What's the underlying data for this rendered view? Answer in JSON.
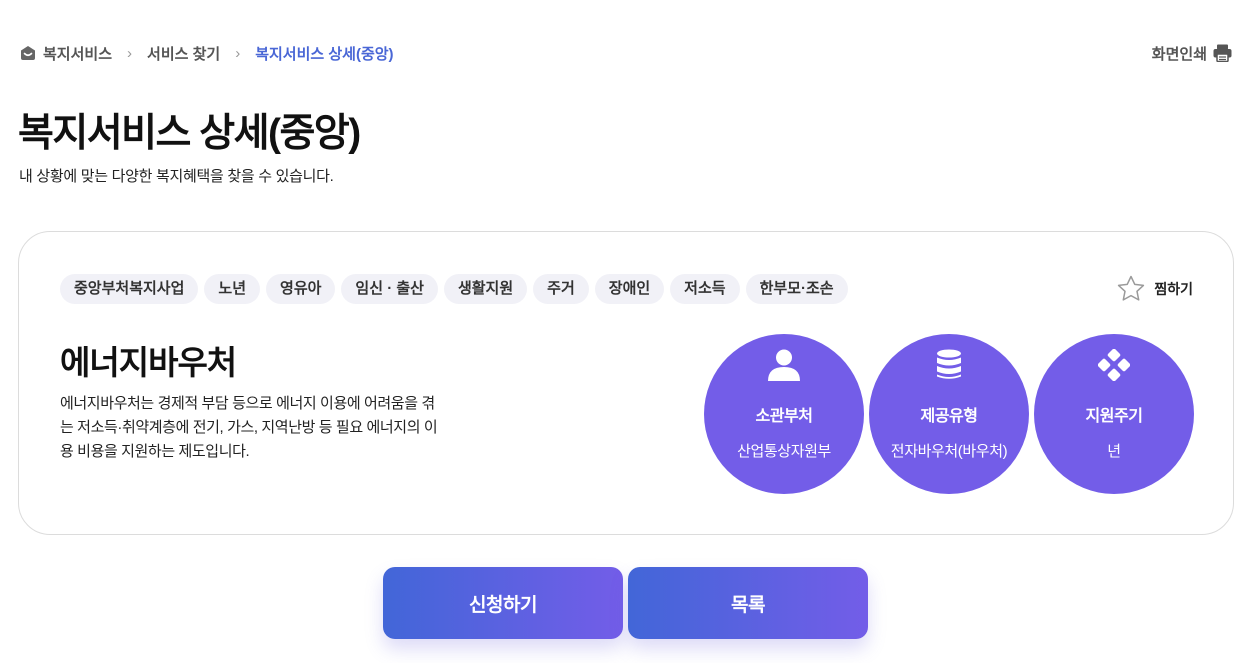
{
  "breadcrumb": {
    "items": [
      "복지서비스",
      "서비스 찾기",
      "복지서비스 상세(중앙)"
    ]
  },
  "print_label": "화면인쇄",
  "page": {
    "title": "복지서비스 상세(중앙)",
    "subtitle": "내 상황에 맞는 다양한 복지혜택을 찾을 수 있습니다."
  },
  "service": {
    "tags": [
      "중앙부처복지사업",
      "노년",
      "영유아",
      "임신 · 출산",
      "생활지원",
      "주거",
      "장애인",
      "저소득",
      "한부모·조손"
    ],
    "favorite_label": "찜하기",
    "title": "에너지바우처",
    "description": "에너지바우처는 경제적 부담 등으로 에너지 이용에 어려움을 겪는 저소득·취약계층에 전기, 가스, 지역난방 등 필요 에너지의 이용 비용을 지원하는 제도입니다.",
    "info": [
      {
        "icon": "person-icon",
        "label": "소관부처",
        "value": "산업통상자원부"
      },
      {
        "icon": "database-icon",
        "label": "제공유형",
        "value": "전자바우처(바우처)"
      },
      {
        "icon": "cycle-icon",
        "label": "지원주기",
        "value": "년"
      }
    ]
  },
  "actions": {
    "apply_label": "신청하기",
    "list_label": "목록"
  },
  "colors": {
    "accent": "#735de8",
    "gradient_start": "#4266d8",
    "breadcrumb_current": "#4a67d6"
  }
}
